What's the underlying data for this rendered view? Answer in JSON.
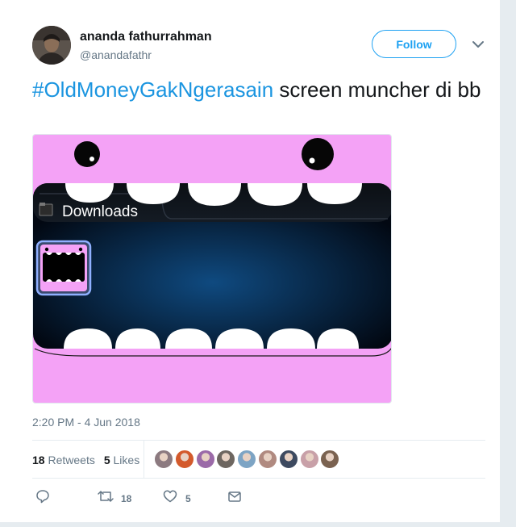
{
  "tweet": {
    "author": {
      "name": "ananda fathurrahman",
      "handle": "@anandafathr"
    },
    "follow_label": "Follow",
    "hashtag": "#OldMoneyGakNgerasain",
    "text_rest": " screen muncher di bb",
    "media": {
      "folder_label": "Downloads"
    },
    "timestamp": "2:20 PM - 4 Jun 2018",
    "stats": {
      "retweets_count": "18",
      "retweets_label": "Retweets",
      "likes_count": "5",
      "likes_label": "Likes"
    },
    "liker_colors": [
      "#8c7a80",
      "#d35a2c",
      "#9b6aa8",
      "#6d6660",
      "#7da4c4",
      "#b08a80",
      "#3d4a60",
      "#c8a0a8",
      "#7a6250"
    ],
    "actions": {
      "retweet_count": "18",
      "like_count": "5"
    }
  },
  "colors": {
    "accent": "#1da1f2",
    "hashtag": "#1b95e0",
    "muncher_pink": "#f4a2f6"
  }
}
